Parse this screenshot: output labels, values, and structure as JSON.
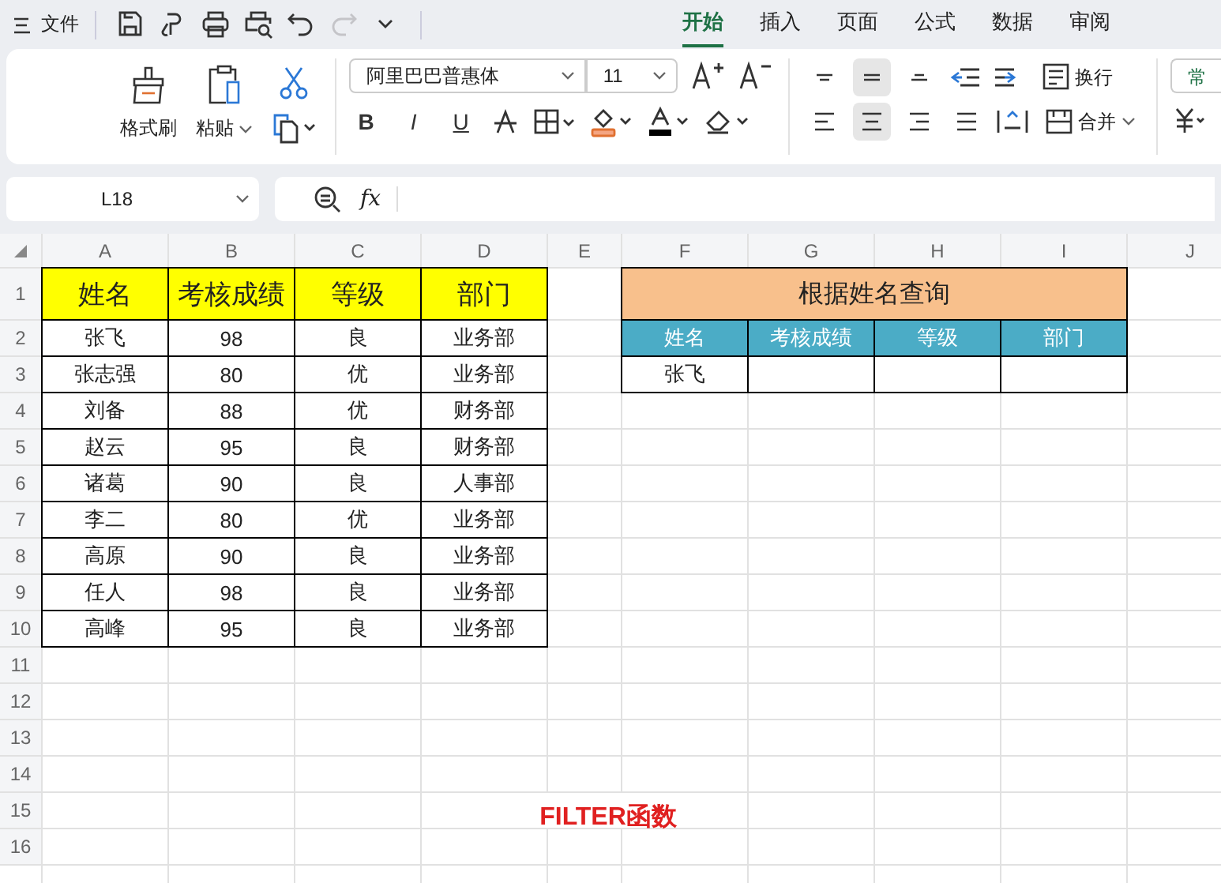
{
  "menu": {
    "label": "文件"
  },
  "quick_access": [
    {
      "kind": "save",
      "disabled": false
    },
    {
      "kind": "share",
      "disabled": false
    },
    {
      "kind": "print",
      "disabled": false
    },
    {
      "kind": "preview",
      "disabled": false
    },
    {
      "kind": "undo",
      "disabled": false
    },
    {
      "kind": "redo",
      "disabled": true
    },
    {
      "kind": "more",
      "disabled": false
    }
  ],
  "tabs": [
    {
      "label": "开始",
      "selected": true
    },
    {
      "label": "插入",
      "selected": false
    },
    {
      "label": "页面",
      "selected": false
    },
    {
      "label": "公式",
      "selected": false
    },
    {
      "label": "数据",
      "selected": false
    },
    {
      "label": "审阅",
      "selected": false
    }
  ],
  "ribbon": {
    "format_painter": "格式刷",
    "paste": "粘贴",
    "font_name": "阿里巴巴普惠体",
    "font_size": "11",
    "bold": "B",
    "italic": "I",
    "underline": "U",
    "vertical_align": [
      {
        "kind": "top",
        "selected": false
      },
      {
        "kind": "middle",
        "selected": true
      },
      {
        "kind": "bottom",
        "selected": false
      }
    ],
    "horizontal_align": [
      {
        "kind": "left",
        "selected": false
      },
      {
        "kind": "center",
        "selected": true
      },
      {
        "kind": "right",
        "selected": false
      },
      {
        "kind": "justify",
        "selected": false
      }
    ],
    "wrap": "换行",
    "merge": "合并",
    "number_format": "常"
  },
  "formula_bar": {
    "name_box": "L18",
    "fx": "fx"
  },
  "columns": [
    "A",
    "B",
    "C",
    "D",
    "E",
    "F",
    "G",
    "H",
    "I",
    "J"
  ],
  "row_numbers": [
    "1",
    "2",
    "3",
    "4",
    "5",
    "6",
    "7",
    "8",
    "9",
    "10",
    "11",
    "12",
    "13",
    "14",
    "15",
    "16"
  ],
  "table": {
    "header": [
      "姓名",
      "考核成绩",
      "等级",
      "部门"
    ],
    "rows": [
      [
        "张飞",
        "98",
        "良",
        "业务部"
      ],
      [
        "张志强",
        "80",
        "优",
        "业务部"
      ],
      [
        "刘备",
        "88",
        "优",
        "财务部"
      ],
      [
        "赵云",
        "95",
        "良",
        "财务部"
      ],
      [
        "诸葛",
        "90",
        "良",
        "人事部"
      ],
      [
        "李二",
        "80",
        "优",
        "业务部"
      ],
      [
        "高原",
        "90",
        "良",
        "业务部"
      ],
      [
        "任人",
        "98",
        "良",
        "业务部"
      ],
      [
        "高峰",
        "95",
        "良",
        "业务部"
      ]
    ]
  },
  "lookup": {
    "title": "根据姓名查询",
    "header": [
      "姓名",
      "考核成绩",
      "等级",
      "部门"
    ],
    "query_name": "张飞"
  },
  "caption": "FILTER函数"
}
